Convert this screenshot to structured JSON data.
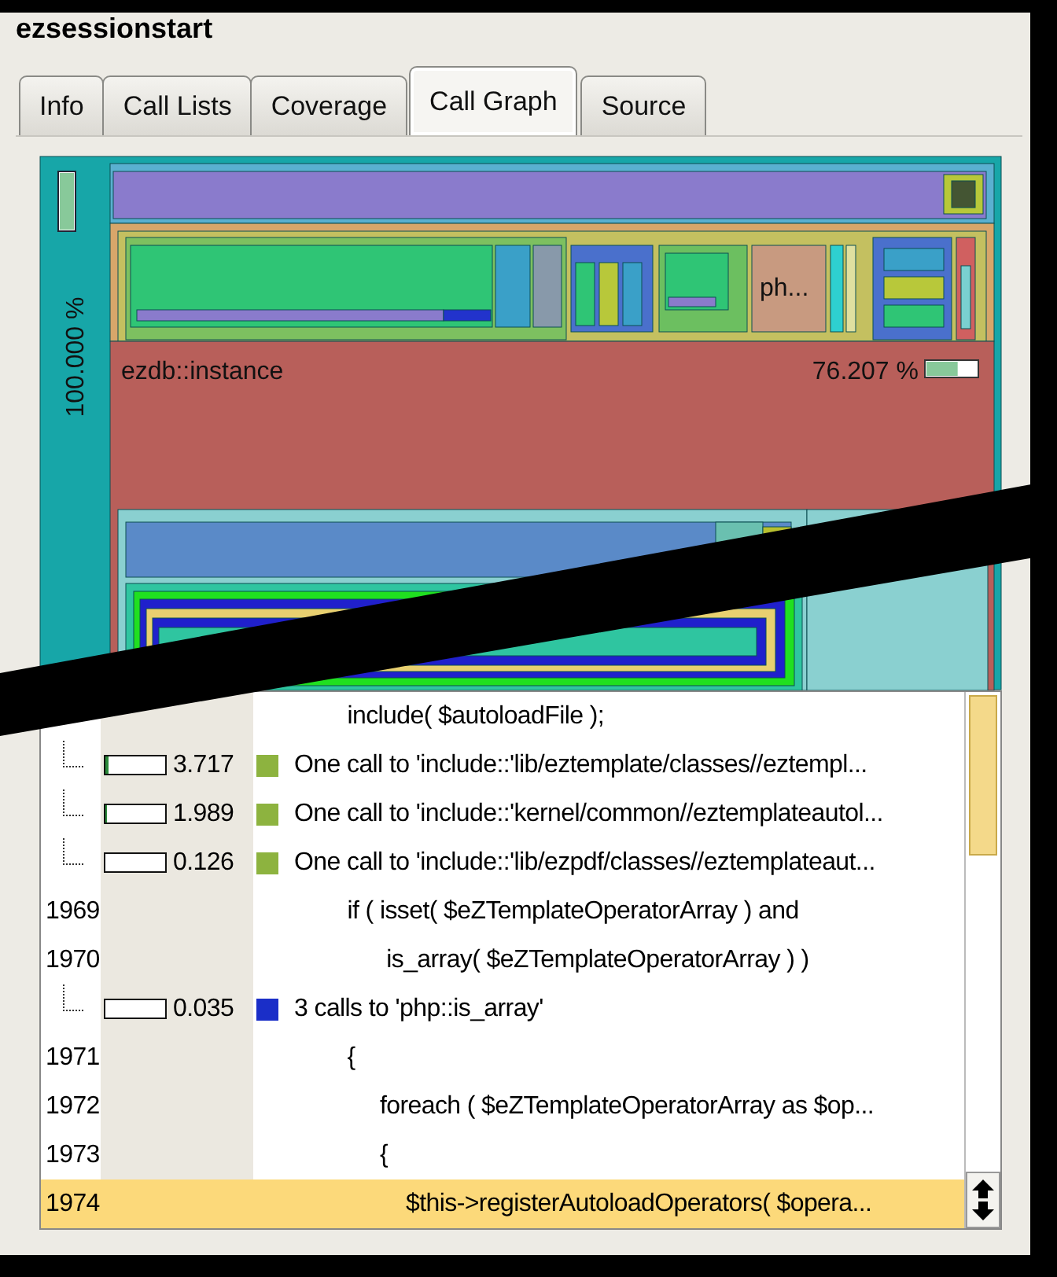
{
  "window": {
    "title": "ezsessionstart"
  },
  "tabs": [
    {
      "label": "Info",
      "selected": false
    },
    {
      "label": "Call Lists",
      "selected": false
    },
    {
      "label": "Coverage",
      "selected": false
    },
    {
      "label": "Call Graph",
      "selected": true
    },
    {
      "label": "Source",
      "selected": false
    }
  ],
  "call_graph": {
    "root": {
      "label": "100.000 %",
      "level": 1
    },
    "small_label": "ph...",
    "focus": {
      "name": "ezdb::instance",
      "percent": "76.207 %",
      "level": 0.62
    }
  },
  "source": {
    "rows": [
      {
        "kind": "code",
        "line": "",
        "code": "            include( $autoloadFile );",
        "selected": false
      },
      {
        "kind": "call",
        "cost": "3.717",
        "level": 0.04,
        "color": "#8db33f",
        "text": "One call to 'include::'lib/eztemplate/classes//eztempl...",
        "selected": false
      },
      {
        "kind": "call",
        "cost": "1.989",
        "level": 0.02,
        "color": "#8db33f",
        "text": "One call to 'include::'kernel/common//eztemplateautol...",
        "selected": false
      },
      {
        "kind": "call",
        "cost": "0.126",
        "level": 0,
        "color": "#8db33f",
        "text": "One call to 'include::'lib/ezpdf/classes//eztemplateaut...",
        "selected": false
      },
      {
        "kind": "code",
        "line": "1969",
        "code": "            if ( isset( $eZTemplateOperatorArray ) and",
        "selected": false
      },
      {
        "kind": "code",
        "line": "1970",
        "code": "                  is_array( $eZTemplateOperatorArray ) )",
        "selected": false
      },
      {
        "kind": "call",
        "cost": "0.035",
        "level": 0,
        "color": "#1a2ec8",
        "text": "3 calls to 'php::is_array'",
        "selected": false
      },
      {
        "kind": "code",
        "line": "1971",
        "code": "            {",
        "selected": false
      },
      {
        "kind": "code",
        "line": "1972",
        "code": "                 foreach ( $eZTemplateOperatorArray as $op...",
        "selected": false
      },
      {
        "kind": "code",
        "line": "1973",
        "code": "                 {",
        "selected": false
      },
      {
        "kind": "code",
        "line": "1974",
        "code": "                     $this->registerAutoloadOperators( $opera...",
        "selected": true
      }
    ]
  }
}
